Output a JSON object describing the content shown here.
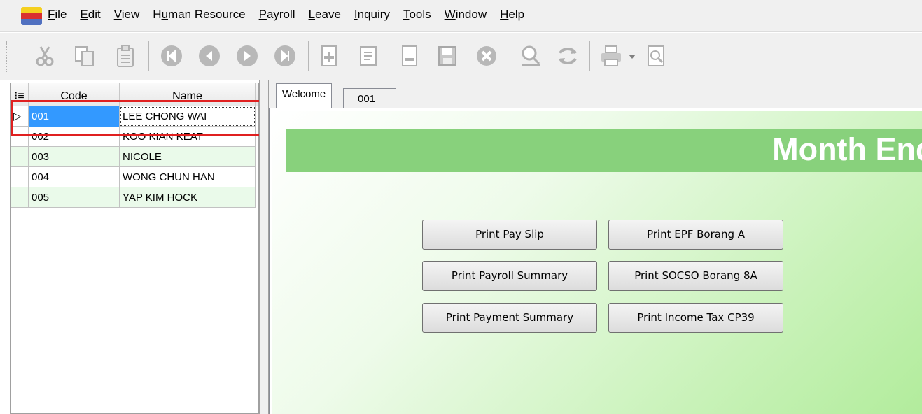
{
  "menu": [
    "File",
    "Edit",
    "View",
    "Human Resource",
    "Payroll",
    "Leave",
    "Inquiry",
    "Tools",
    "Window",
    "Help"
  ],
  "toolbar_icons": [
    "cut-icon",
    "copy-icon",
    "paste-icon",
    "first-record-icon",
    "previous-record-icon",
    "next-record-icon",
    "last-record-icon",
    "new-icon",
    "edit-icon",
    "delete-icon",
    "save-icon",
    "cancel-icon",
    "find-icon",
    "refresh-icon",
    "print-icon",
    "print-preview-icon"
  ],
  "grid": {
    "header": {
      "code": "Code",
      "name": "Name"
    },
    "rows": [
      {
        "code": "001",
        "name": "LEE CHONG WAI"
      },
      {
        "code": "002",
        "name": "KOO KIAN KEAT"
      },
      {
        "code": "003",
        "name": "NICOLE"
      },
      {
        "code": "004",
        "name": "WONG CHUN HAN"
      },
      {
        "code": "005",
        "name": "YAP KIM HOCK"
      }
    ]
  },
  "tabs": {
    "welcome": "Welcome",
    "record": "001"
  },
  "banner": {
    "title": "Month End (("
  },
  "buttons": {
    "pay_slip": "Print Pay Slip",
    "epf": "Print EPF Borang A",
    "payroll_summary": "Print Payroll Summary",
    "socso": "Print SOCSO Borang 8A",
    "payment_summary": "Print Payment Summary",
    "income_tax": "Print Income Tax CP39"
  },
  "colors": {
    "accent_green": "#88d17c",
    "selection_blue": "#3399ff",
    "highlight_red": "#e02020"
  }
}
